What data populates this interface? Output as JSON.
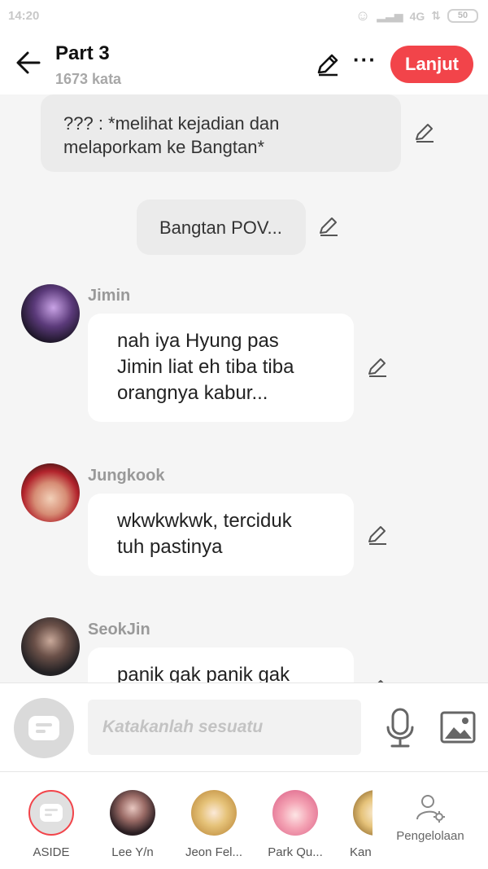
{
  "status": {
    "time": "14:20",
    "network": "4G",
    "battery": "50"
  },
  "header": {
    "title": "Part 3",
    "word_count": "1673 kata",
    "continue_label": "Lanjut",
    "more_label": "···"
  },
  "chat": {
    "narration_1": [
      "??? : *melihat kejadian dan",
      "melaporkam ke Bangtan*"
    ],
    "narration_2": "Bangtan POV...",
    "messages": [
      {
        "name": "Jimin",
        "lines": [
          "nah iya Hyung pas",
          "Jimin liat eh tiba tiba",
          "orangnya kabur..."
        ]
      },
      {
        "name": "Jungkook",
        "lines": [
          "wkwkwkwk, terciduk",
          "tuh pastinya"
        ]
      },
      {
        "name": "SeokJin",
        "lines": [
          "panik gak panik gak"
        ]
      }
    ]
  },
  "composer": {
    "placeholder": "Katakanlah sesuatu"
  },
  "cast": {
    "members": [
      {
        "label": "ASIDE"
      },
      {
        "label": "Lee Y/n"
      },
      {
        "label": "Jeon Fel..."
      },
      {
        "label": "Park Qu..."
      },
      {
        "label": "Kan"
      }
    ],
    "manage_label": "Pengelolaan"
  },
  "colors": {
    "accent": "#f2444a",
    "bubble": "#ffffff",
    "narration": "#ebebeb",
    "background": "#f5f5f5"
  }
}
